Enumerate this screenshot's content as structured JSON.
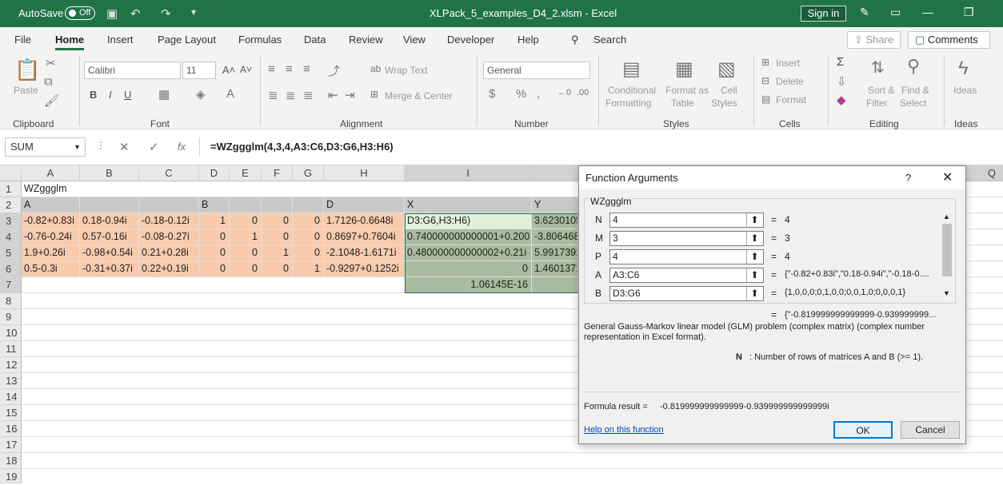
{
  "titlebar": {
    "autosave": "AutoSave",
    "toggle": "Off",
    "title": "XLPack_5_examples_D4_2.xlsm  -  Excel",
    "signin": "Sign in"
  },
  "menu": {
    "tabs": [
      "File",
      "Home",
      "Insert",
      "Page Layout",
      "Formulas",
      "Data",
      "Review",
      "View",
      "Developer",
      "Help"
    ],
    "search": "Search",
    "share": "Share",
    "comments": "Comments"
  },
  "ribbon": {
    "clipboard": {
      "group": "Clipboard",
      "paste": "Paste"
    },
    "font": {
      "group": "Font",
      "name": "Calibri",
      "size": "11"
    },
    "alignment": {
      "group": "Alignment",
      "wrap": "Wrap Text",
      "merge": "Merge & Center"
    },
    "number": {
      "group": "Number",
      "format": "General"
    },
    "styles": {
      "group": "Styles",
      "cond1": "Conditional",
      "cond2": "Formatting",
      "fmt1": "Format as",
      "fmt2": "Table",
      "cell1": "Cell",
      "cell2": "Styles"
    },
    "cells": {
      "group": "Cells",
      "insert": "Insert",
      "delete": "Delete",
      "format": "Format"
    },
    "editing": {
      "group": "Editing",
      "sort1": "Sort &",
      "sort2": "Filter",
      "find1": "Find &",
      "find2": "Select"
    },
    "ideas": {
      "group": "Ideas",
      "label": "Ideas"
    }
  },
  "formula_bar": {
    "namebox": "SUM",
    "fx": "fx",
    "formula": "=WZggglm(4,3,4,A3:C6,D3:G6,H3:H6)"
  },
  "sheet": {
    "columns": [
      "A",
      "B",
      "C",
      "D",
      "E",
      "F",
      "G",
      "H",
      "I",
      "",
      "Q"
    ],
    "rows": [
      "1",
      "2",
      "3",
      "4",
      "5",
      "6",
      "7",
      "8",
      "9",
      "10",
      "11",
      "12",
      "13",
      "14",
      "15",
      "16",
      "17",
      "18",
      "19"
    ],
    "r1": {
      "a": "WZggglm"
    },
    "r2": {
      "a": "A",
      "d": "B",
      "h": "D",
      "i": "X",
      "j": "Y"
    },
    "data": [
      {
        "a": "-0.82+0.83i",
        "b": "0.18-0.94i",
        "c": "-0.18-0.12i",
        "d": "1",
        "e": "0",
        "f": "0",
        "g": "0",
        "h": "1.7126-0.6648i",
        "i": "D3:G6,H3:H6)",
        "j": "3.6230105"
      },
      {
        "a": "-0.76-0.24i",
        "b": "0.57-0.16i",
        "c": "-0.08-0.27i",
        "d": "0",
        "e": "1",
        "f": "0",
        "g": "0",
        "h": "0.8697+0.7604i",
        "i": "0.740000000000001+0.200",
        "j": "-3.806468"
      },
      {
        "a": "1.9+0.26i",
        "b": "-0.98+0.54i",
        "c": "0.21+0.28i",
        "d": "0",
        "e": "0",
        "f": "1",
        "g": "0",
        "h": "-2.1048-1.6171i",
        "i": "0.480000000000002+0.21i",
        "j": "5.9917391"
      },
      {
        "a": "0.5-0.3i",
        "b": "-0.31+0.37i",
        "c": "0.22+0.19i",
        "d": "0",
        "e": "0",
        "f": "0",
        "g": "1",
        "h": "-0.9297+0.1252i",
        "i": "0",
        "j": "1.4601371"
      }
    ],
    "r7": {
      "i": "1.06145E-16"
    }
  },
  "dialog": {
    "title": "Function Arguments",
    "help": "?",
    "fname": "WZggglm",
    "args": [
      {
        "label": "N",
        "value": "4",
        "result": "4"
      },
      {
        "label": "M",
        "value": "3",
        "result": "3"
      },
      {
        "label": "P",
        "value": "4",
        "result": "4"
      },
      {
        "label": "A",
        "value": "A3:C6",
        "result": "{\"-0.82+0.83i\",\"0.18-0.94i\",\"-0.18-0...."
      },
      {
        "label": "B",
        "value": "D3:G6",
        "result": "{1,0,0,0;0,1,0,0;0,0,1,0;0,0,0,1}"
      }
    ],
    "total": "{\"-0.819999999999999-0.939999999...",
    "description": "General Gauss-Markov linear model (GLM) problem (complex matrix) (complex number representation in Excel format).",
    "arg_name": "N",
    "arg_help": ": Number of rows of matrices A and B (>= 1).",
    "result_label": "Formula result =",
    "result": "-0.819999999999999-0.939999999999999i",
    "help_link": "Help on this function",
    "ok": "OK",
    "cancel": "Cancel"
  }
}
